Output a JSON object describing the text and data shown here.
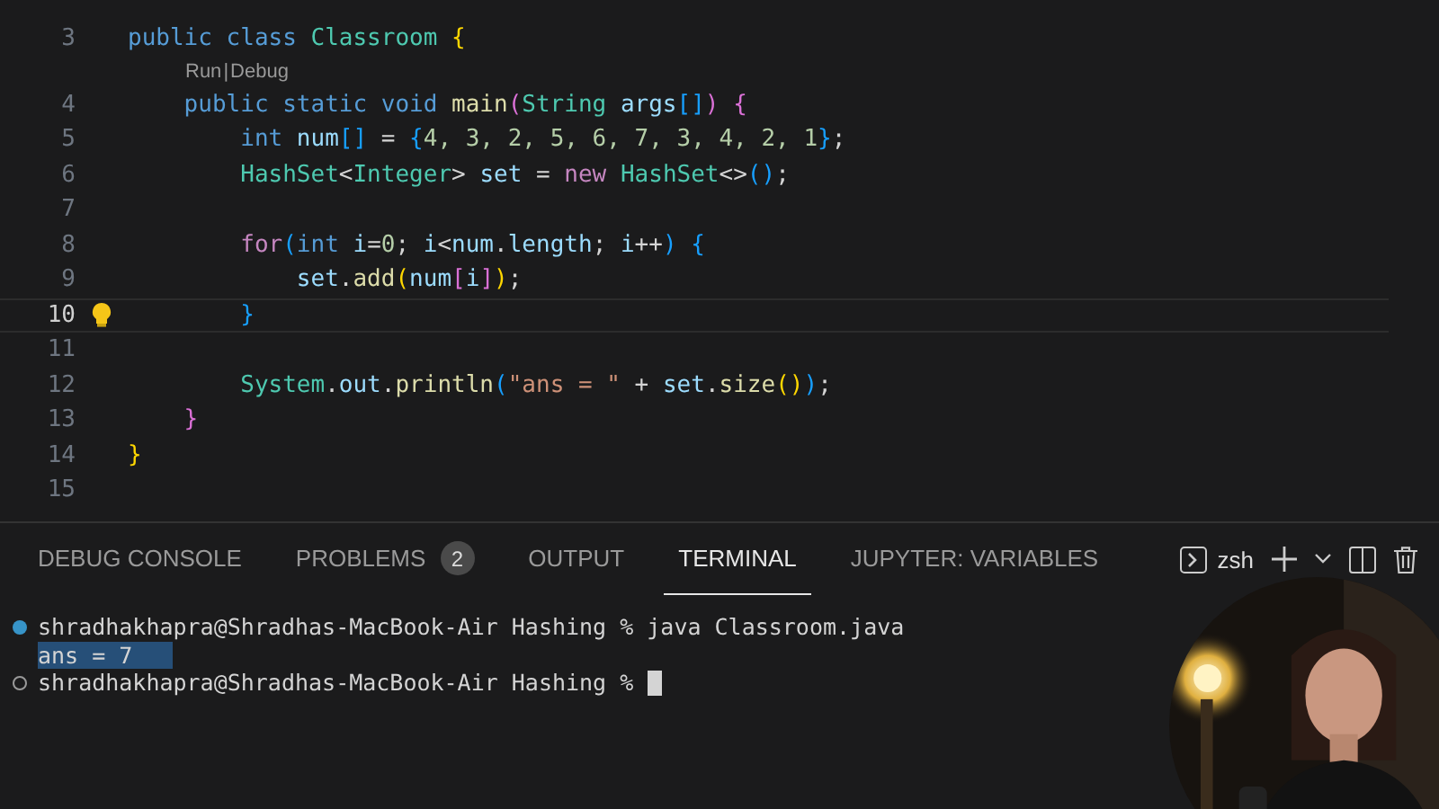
{
  "editor": {
    "lines": [
      {
        "number": "3",
        "current": false,
        "tokens": [
          {
            "kind": "kw",
            "text": "public class "
          },
          {
            "kind": "type",
            "text": "Classroom"
          },
          {
            "kind": "b1",
            "text": " {"
          }
        ]
      },
      {
        "kind": "codelens",
        "links": [
          "Run",
          "Debug"
        ],
        "separator": "|"
      },
      {
        "number": "4",
        "current": false,
        "tokens": [
          {
            "kind": "kw",
            "text": "    public static void "
          },
          {
            "kind": "fn",
            "text": "main"
          },
          {
            "kind": "b2",
            "text": "("
          },
          {
            "kind": "type",
            "text": "String "
          },
          {
            "kind": "var",
            "text": "args"
          },
          {
            "kind": "b3",
            "text": "[]"
          },
          {
            "kind": "b2",
            "text": ")"
          },
          {
            "kind": "b2",
            "text": " {"
          }
        ]
      },
      {
        "number": "5",
        "current": false,
        "tokens": [
          {
            "kind": "kw",
            "text": "        int "
          },
          {
            "kind": "var",
            "text": "num"
          },
          {
            "kind": "b3",
            "text": "[]"
          },
          {
            "kind": "plain",
            "text": " = "
          },
          {
            "kind": "b3",
            "text": "{"
          },
          {
            "kind": "num",
            "text": "4, 3, 2, 5, 6, 7, 3, 4, 2, 1"
          },
          {
            "kind": "b3",
            "text": "}"
          },
          {
            "kind": "plain",
            "text": ";"
          }
        ]
      },
      {
        "number": "6",
        "current": false,
        "tokens": [
          {
            "kind": "type",
            "text": "        HashSet"
          },
          {
            "kind": "plain",
            "text": "<"
          },
          {
            "kind": "type",
            "text": "Integer"
          },
          {
            "kind": "plain",
            "text": "> "
          },
          {
            "kind": "var",
            "text": "set"
          },
          {
            "kind": "plain",
            "text": " = "
          },
          {
            "kind": "ctl",
            "text": "new "
          },
          {
            "kind": "type",
            "text": "HashSet"
          },
          {
            "kind": "plain",
            "text": "<>"
          },
          {
            "kind": "b3",
            "text": "()"
          },
          {
            "kind": "plain",
            "text": ";"
          }
        ]
      },
      {
        "number": "7",
        "current": false
      },
      {
        "number": "8",
        "current": false,
        "tokens": [
          {
            "kind": "ctl",
            "text": "        for"
          },
          {
            "kind": "b3",
            "text": "("
          },
          {
            "kind": "kw",
            "text": "int "
          },
          {
            "kind": "var",
            "text": "i"
          },
          {
            "kind": "plain",
            "text": "="
          },
          {
            "kind": "num",
            "text": "0"
          },
          {
            "kind": "plain",
            "text": "; "
          },
          {
            "kind": "var",
            "text": "i"
          },
          {
            "kind": "plain",
            "text": "<"
          },
          {
            "kind": "var",
            "text": "num"
          },
          {
            "kind": "plain",
            "text": "."
          },
          {
            "kind": "var",
            "text": "length"
          },
          {
            "kind": "plain",
            "text": "; "
          },
          {
            "kind": "var",
            "text": "i"
          },
          {
            "kind": "plain",
            "text": "++"
          },
          {
            "kind": "b3",
            "text": ")"
          },
          {
            "kind": "b3",
            "text": " {"
          }
        ]
      },
      {
        "number": "9",
        "current": false,
        "tokens": [
          {
            "kind": "var",
            "text": "            set"
          },
          {
            "kind": "plain",
            "text": "."
          },
          {
            "kind": "fn",
            "text": "add"
          },
          {
            "kind": "b1",
            "text": "("
          },
          {
            "kind": "var",
            "text": "num"
          },
          {
            "kind": "b2",
            "text": "["
          },
          {
            "kind": "var",
            "text": "i"
          },
          {
            "kind": "b2",
            "text": "]"
          },
          {
            "kind": "b1",
            "text": ")"
          },
          {
            "kind": "plain",
            "text": ";"
          }
        ]
      },
      {
        "number": "10",
        "current": true,
        "lightbulb": true,
        "tokens": [
          {
            "kind": "b3",
            "text": "        }"
          }
        ]
      },
      {
        "number": "11",
        "current": false
      },
      {
        "number": "12",
        "current": false,
        "tokens": [
          {
            "kind": "type",
            "text": "        System"
          },
          {
            "kind": "plain",
            "text": "."
          },
          {
            "kind": "var",
            "text": "out"
          },
          {
            "kind": "plain",
            "text": "."
          },
          {
            "kind": "fn",
            "text": "println"
          },
          {
            "kind": "b3",
            "text": "("
          },
          {
            "kind": "str",
            "text": "\"ans = \""
          },
          {
            "kind": "plain",
            "text": " + "
          },
          {
            "kind": "var",
            "text": "set"
          },
          {
            "kind": "plain",
            "text": "."
          },
          {
            "kind": "fn",
            "text": "size"
          },
          {
            "kind": "b1",
            "text": "()"
          },
          {
            "kind": "b3",
            "text": ")"
          },
          {
            "kind": "plain",
            "text": ";"
          }
        ]
      },
      {
        "number": "13",
        "current": false,
        "tokens": [
          {
            "kind": "b2",
            "text": "    }"
          }
        ]
      },
      {
        "number": "14",
        "current": false,
        "tokens": [
          {
            "kind": "b1",
            "text": "}"
          }
        ]
      },
      {
        "number": "15",
        "current": false
      }
    ]
  },
  "panel": {
    "tabs": [
      {
        "label": "DEBUG CONSOLE",
        "selected": false
      },
      {
        "label": "PROBLEMS",
        "badge": "2",
        "selected": false
      },
      {
        "label": "OUTPUT",
        "selected": false
      },
      {
        "label": "TERMINAL",
        "selected": true
      },
      {
        "label": "JUPYTER: VARIABLES",
        "selected": false
      }
    ],
    "shell": "zsh",
    "terminal": [
      {
        "kind": "success",
        "text": "shradhakhapra@Shradhas-MacBook-Air Hashing % java Classroom.java",
        "selected": false
      },
      {
        "kind": "output",
        "text": "ans = 7",
        "selected": true
      },
      {
        "kind": "pending",
        "text": "shradhakhapra@Shradhas-MacBook-Air Hashing % ",
        "selected": false,
        "cursor": true
      }
    ]
  }
}
